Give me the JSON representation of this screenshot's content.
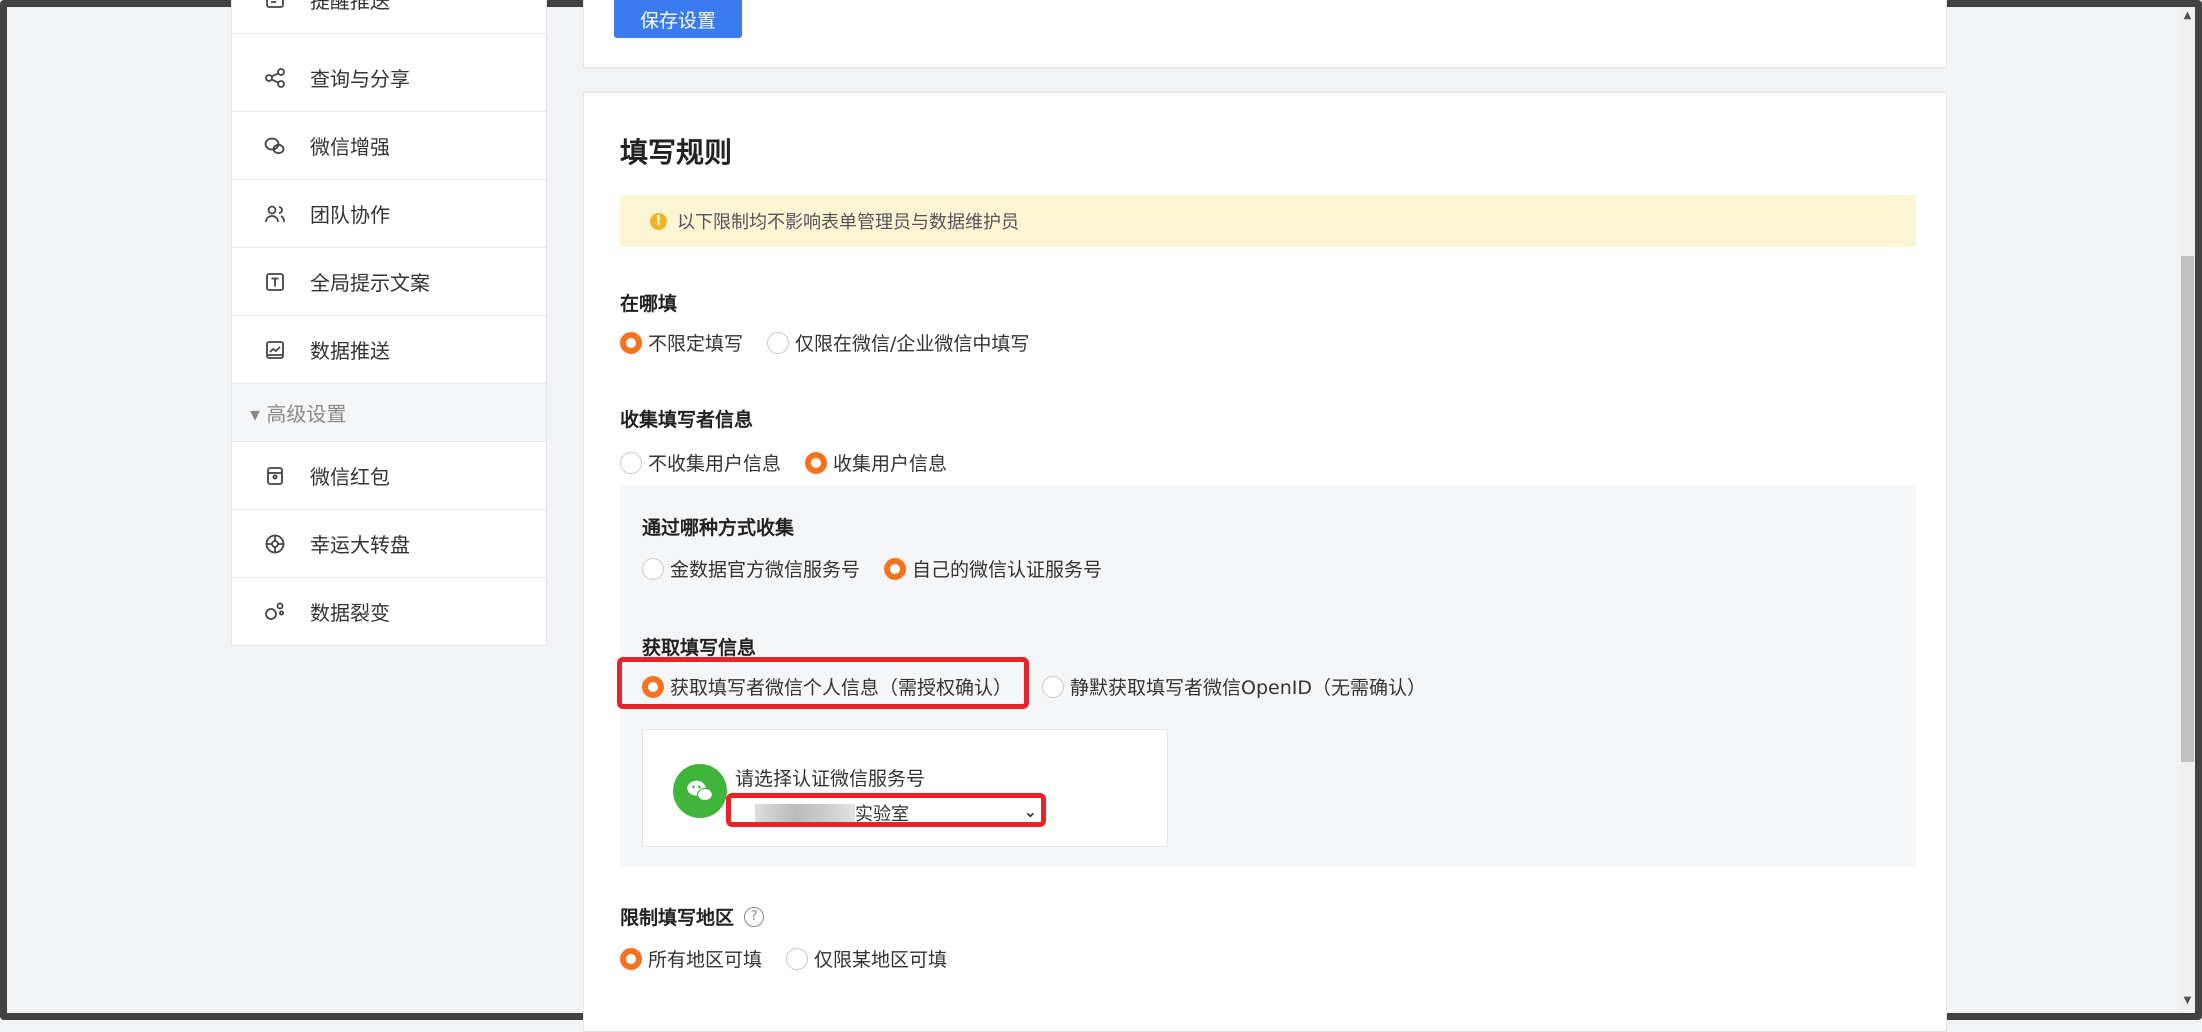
{
  "sidebar": {
    "items": [
      {
        "label": "提醒推送",
        "icon": "notify-icon"
      },
      {
        "label": "查询与分享",
        "icon": "share-icon"
      },
      {
        "label": "微信增强",
        "icon": "wechat-icon"
      },
      {
        "label": "团队协作",
        "icon": "team-icon"
      },
      {
        "label": "全局提示文案",
        "icon": "text-icon"
      },
      {
        "label": "数据推送",
        "icon": "chart-icon"
      }
    ],
    "group_label": "▾ 高级设置",
    "advanced_items": [
      {
        "label": "微信红包",
        "icon": "redpacket-icon"
      },
      {
        "label": "幸运大转盘",
        "icon": "wheel-icon"
      },
      {
        "label": "数据裂变",
        "icon": "fission-icon"
      }
    ]
  },
  "top": {
    "save_label": "保存设置"
  },
  "rules": {
    "title": "填写规则",
    "notice": "以下限制均不影响表单管理员与数据维护员",
    "where": {
      "label": "在哪填",
      "options": [
        "不限定填写",
        "仅限在微信/企业微信中填写"
      ],
      "selected": 0
    },
    "collect": {
      "label": "收集填写者信息",
      "options": [
        "不收集用户信息",
        "收集用户信息"
      ],
      "selected": 1
    },
    "method": {
      "label": "通过哪种方式收集",
      "options": [
        "金数据官方微信服务号",
        "自己的微信认证服务号"
      ],
      "selected": 1
    },
    "fetch": {
      "label": "获取填写信息",
      "options": [
        "获取填写者微信个人信息（需授权确认）",
        "静默获取填写者微信OpenID（无需确认）"
      ],
      "selected": 0
    },
    "service": {
      "label": "请选择认证微信服务号",
      "selected_value": "实验室"
    },
    "region": {
      "label": "限制填写地区",
      "help": "?",
      "options": [
        "所有地区可填",
        "仅限某地区可填"
      ],
      "selected": 0
    }
  },
  "colors": {
    "accent": "#f5731f",
    "primary": "#3b7bf0",
    "highlight": "#e8242a",
    "wechat": "#3fb53c"
  }
}
